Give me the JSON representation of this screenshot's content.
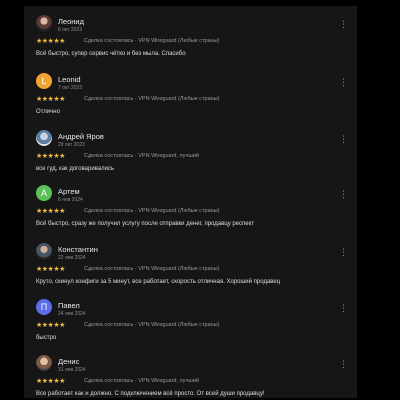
{
  "reviews": [
    {
      "name": "Леонид",
      "date": "6 окт 2023",
      "meta": "Сделка состоялась · VPN Wireguard (Любые страны)",
      "text": "Всё быстро, супер сервис чётко и без мыла. Спасибо",
      "avatar": "photo",
      "initial": ""
    },
    {
      "name": "Leonid",
      "date": "7 окт 2023",
      "meta": "Сделка состоялась · VPN Wireguard (Любые страны)",
      "text": "Отлично",
      "avatar": "letter",
      "initial": "L",
      "color": "#f2a531"
    },
    {
      "name": "Андрей Яров",
      "date": "29 окт 2023",
      "meta": "Сделка состоялась · VPN Wireguard, лучший",
      "text": "все гуд, как договаривались",
      "avatar": "photo2",
      "initial": ""
    },
    {
      "name": "Артем",
      "date": "6 янв 2024",
      "meta": "Сделка состоялась · VPN Wireguard (Любые страны)",
      "text": "Всё быстро, сразу же получил услугу после отправки денег, продавцу респект",
      "avatar": "letter",
      "initial": "A",
      "color": "#5cc05a"
    },
    {
      "name": "Константин",
      "date": "22 янв 2024",
      "meta": "Сделка состоялась · VPN Wireguard (Любые страны)",
      "text": "Круто, скинул конфиги за 5 минут, все работает, скорость отличная. Хороший продавец",
      "avatar": "photo3",
      "initial": ""
    },
    {
      "name": "Павел",
      "date": "24 янв 2024",
      "meta": "Сделка состоялась · VPN Wireguard (Любые страны)",
      "text": "быстро",
      "avatar": "letter",
      "initial": "П",
      "color": "#5b6ee8"
    },
    {
      "name": "Денис",
      "date": "31 янв 2024",
      "meta": "Сделка состоялась · VPN Wireguard, лучший",
      "text": "Все работает как и должно. С подключением всё просто. От всей души продавцу!",
      "avatar": "photo4",
      "initial": ""
    }
  ],
  "stars": "★★★★★",
  "more_icon": "⋮"
}
